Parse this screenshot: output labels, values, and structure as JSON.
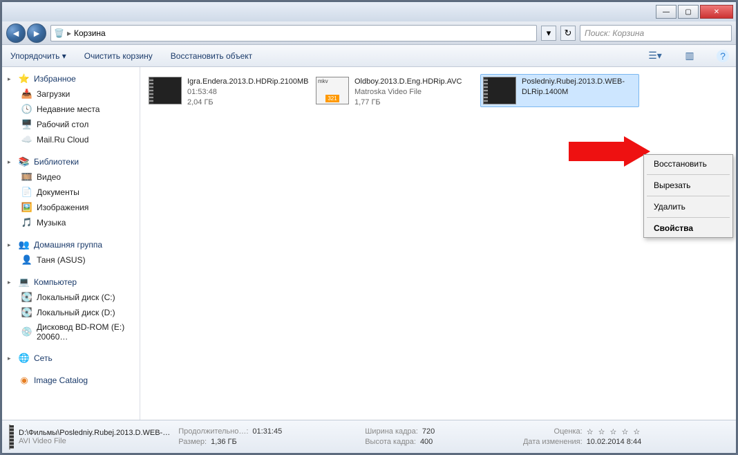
{
  "titlebar": {
    "min": "—",
    "max": "▢",
    "close": "✕"
  },
  "address": {
    "location": "Корзина",
    "separator": "▸",
    "search_placeholder": "Поиск: Корзина"
  },
  "toolbar": {
    "organize": "Упорядочить ▾",
    "empty": "Очистить корзину",
    "restore": "Восстановить объект"
  },
  "sidebar": {
    "favorites": {
      "label": "Избранное",
      "items": [
        {
          "icon": "📥",
          "label": "Загрузки"
        },
        {
          "icon": "🕓",
          "label": "Недавние места"
        },
        {
          "icon": "🖥️",
          "label": "Рабочий стол"
        },
        {
          "icon": "☁️",
          "label": "Mail.Ru Cloud"
        }
      ]
    },
    "libraries": {
      "label": "Библиотеки",
      "items": [
        {
          "icon": "🎞️",
          "label": "Видео"
        },
        {
          "icon": "📄",
          "label": "Документы"
        },
        {
          "icon": "🖼️",
          "label": "Изображения"
        },
        {
          "icon": "🎵",
          "label": "Музыка"
        }
      ]
    },
    "homegroup": {
      "label": "Домашняя группа",
      "items": [
        {
          "icon": "👤",
          "label": "Таня (ASUS)"
        }
      ]
    },
    "computer": {
      "label": "Компьютер",
      "items": [
        {
          "icon": "💽",
          "label": "Локальный диск (C:)"
        },
        {
          "icon": "💽",
          "label": "Локальный диск (D:)"
        },
        {
          "icon": "💿",
          "label": "Дисковод BD-ROM (E:) 20060…"
        }
      ]
    },
    "network": {
      "label": "Сеть"
    },
    "catalog": {
      "label": "Image Catalog"
    }
  },
  "files": [
    {
      "name": "Igra.Endera.2013.D.HDRip.2100MB",
      "line2": "01:53:48",
      "line3": "2,04 ГБ",
      "type": "video"
    },
    {
      "name": "Oldboy.2013.D.Eng.HDRip.AVC",
      "line2": "Matroska Video File",
      "line3": "1,77 ГБ",
      "type": "mkv",
      "mkv_label": "mkv"
    },
    {
      "name": "Posledniy.Rubej.2013.D.WEB-DLRip.1400M",
      "line2": "",
      "line3": "",
      "type": "video",
      "selected": true
    }
  ],
  "context_menu": {
    "restore": "Восстановить",
    "cut": "Вырезать",
    "delete": "Удалить",
    "properties": "Свойства"
  },
  "status": {
    "path": "D:\\Фильмы\\Posledniy.Rubej.2013.D.WEB-…",
    "filetype": "AVI Video File",
    "duration_label": "Продолжительно…:",
    "duration": "01:31:45",
    "size_label": "Размер:",
    "size": "1,36 ГБ",
    "width_label": "Ширина кадра:",
    "width": "720",
    "height_label": "Высота кадра:",
    "height": "400",
    "rating_label": "Оценка:",
    "rating": "☆ ☆ ☆ ☆ ☆",
    "date_label": "Дата изменения:",
    "date": "10.02.2014 8:44"
  }
}
